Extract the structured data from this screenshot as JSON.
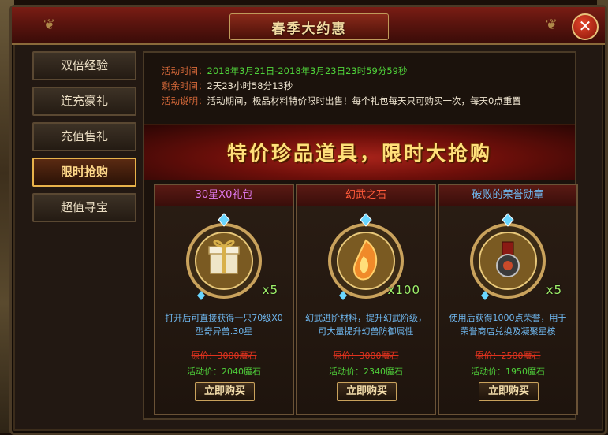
{
  "window": {
    "title": "春季大约惠",
    "close_label": "✕"
  },
  "sidebar": {
    "items": [
      {
        "label": "双倍经验",
        "active": false
      },
      {
        "label": "连充豪礼",
        "active": false
      },
      {
        "label": "充值售礼",
        "active": false
      },
      {
        "label": "限时抢购",
        "active": true
      },
      {
        "label": "超值寻宝",
        "active": false
      }
    ]
  },
  "info": {
    "time_label": "活动时间：",
    "time_value": "2018年3月21日-2018年3月23日23时59分59秒",
    "remain_label": "剩余时间：",
    "remain_value": "2天23小时58分13秒",
    "desc_label": "活动说明：",
    "desc_value": "活动期间，极品材料特价限时出售！每个礼包每天只可购买一次，每天0点重置"
  },
  "banner": {
    "text": "特价珍品道具，限时大抢购"
  },
  "cards": [
    {
      "name": "30星X0礼包",
      "name_color": "#e07af0",
      "icon": "gift-box-icon",
      "quantity": "x5",
      "description": "打开后可直接获得一只70级X0型奇异兽.30星",
      "original_price": "原价：3000魔石",
      "promo_price": "活动价：2040魔石",
      "buy_label": "立即购买"
    },
    {
      "name": "幻武之石",
      "name_color": "#ff5a3a",
      "icon": "fire-stone-icon",
      "quantity": "x100",
      "description": "幻武进阶材料，提升幻武阶级，可大量提升幻兽防御属性",
      "original_price": "原价：3000魔石",
      "promo_price": "活动价：2340魔石",
      "buy_label": "立即购买"
    },
    {
      "name": "破败的荣誉勋章",
      "name_color": "#6fb8f0",
      "icon": "medal-icon",
      "quantity": "x5",
      "description": "使用后获得1000点荣誉，用于荣誉商店兑换及凝聚星核",
      "original_price": "原价：2500魔石",
      "promo_price": "活动价：1950魔石",
      "buy_label": "立即购买"
    }
  ]
}
